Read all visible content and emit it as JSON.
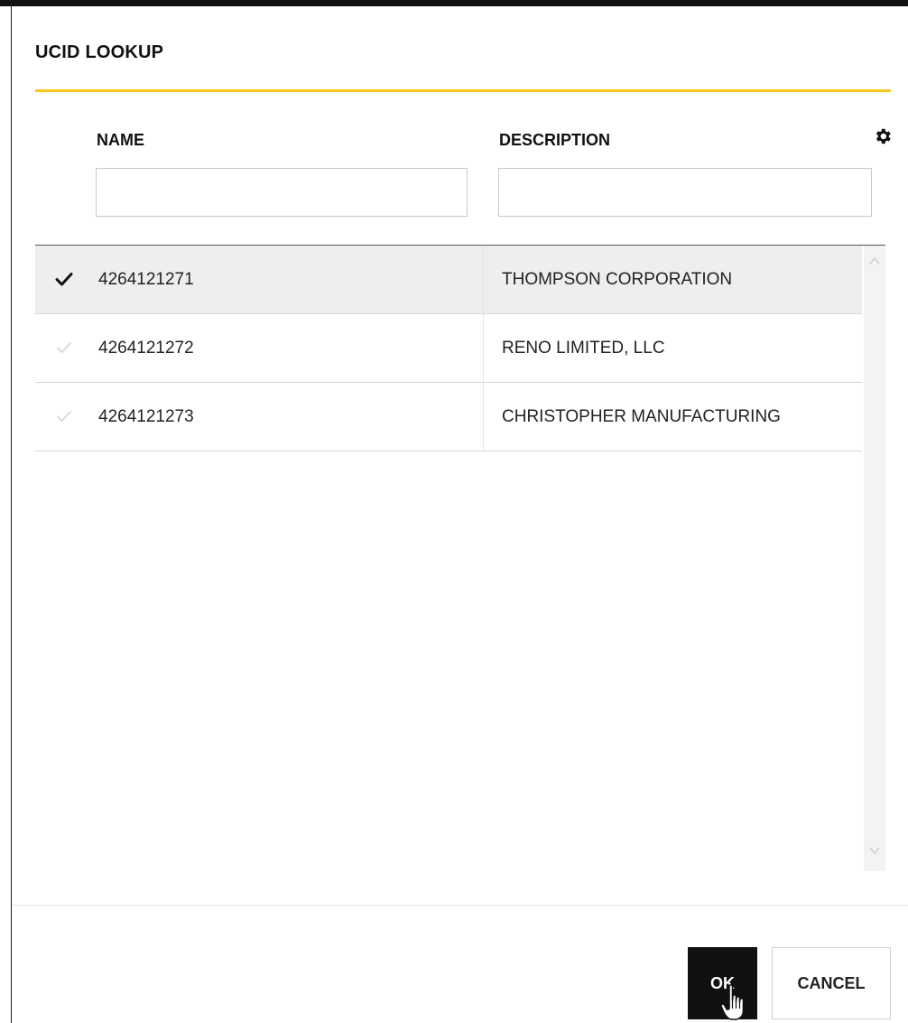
{
  "dialog": {
    "title": "UCID LOOKUP",
    "accent_color": "#f5c518"
  },
  "columns": {
    "name_header": "NAME",
    "description_header": "DESCRIPTION",
    "name_filter_value": "",
    "description_filter_value": "",
    "settings_icon": "gear-icon"
  },
  "rows": [
    {
      "name": "4264121271",
      "description": "THOMPSON CORPORATION",
      "selected": true
    },
    {
      "name": "4264121272",
      "description": "RENO LIMITED, LLC",
      "selected": false
    },
    {
      "name": "4264121273",
      "description": "CHRISTOPHER MANUFACTURING",
      "selected": false
    }
  ],
  "footer": {
    "ok_label": "OK",
    "cancel_label": "CANCEL"
  }
}
